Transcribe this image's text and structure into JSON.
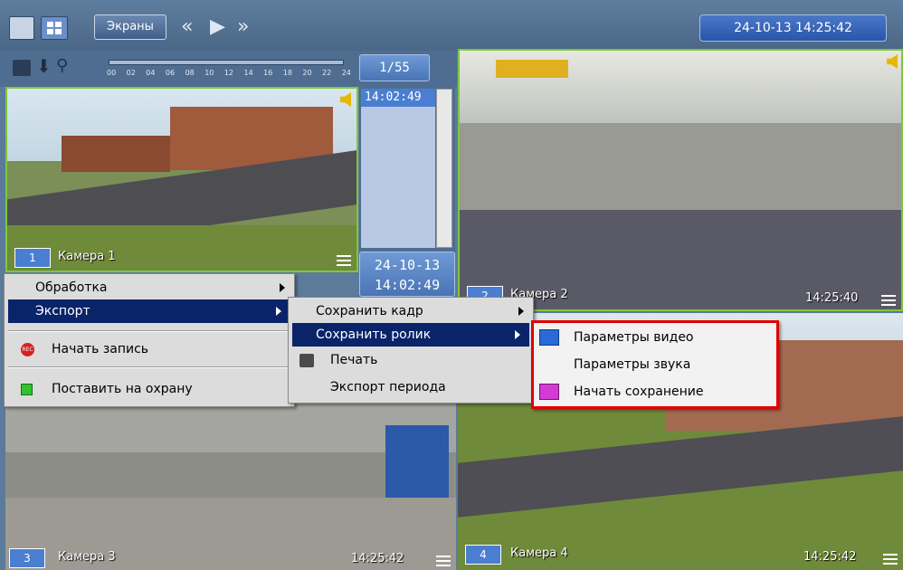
{
  "toolbar": {
    "screens_label": "Экраны",
    "prev_icon": "rewind-icon",
    "play_icon": "play-icon",
    "next_icon": "fast-forward-icon",
    "datetime": "24-10-13  14:25:42"
  },
  "archive": {
    "timeline_ticks": [
      "00",
      "02",
      "04",
      "06",
      "08",
      "10",
      "12",
      "14",
      "16",
      "18",
      "20",
      "22",
      "24"
    ],
    "counter": "1/55",
    "list_item": "14:02:49",
    "date_line1": "24-10-13",
    "date_line2": "14:02:49"
  },
  "cameras": [
    {
      "num": "1",
      "name": "Камера 1",
      "time": ""
    },
    {
      "num": "2",
      "name": "Камера 2",
      "time": "14:25:40"
    },
    {
      "num": "3",
      "name": "Камера 3",
      "time": "14:25:42"
    },
    {
      "num": "4",
      "name": "Камера 4",
      "time": "14:25:42"
    }
  ],
  "context_menu": {
    "items": [
      "Обработка",
      "Экспорт",
      "Начать запись",
      "Поставить на охрану"
    ]
  },
  "export_menu": {
    "items": [
      "Сохранить кадр",
      "Сохранить ролик",
      "Печать",
      "Экспорт периода"
    ]
  },
  "clip_menu": {
    "items": [
      "Параметры видео",
      "Параметры звука",
      "Начать сохранение"
    ]
  },
  "colors": {
    "selection": "#0a246a",
    "highlight_border": "#e00000",
    "cam_border": "#7ec83a"
  }
}
